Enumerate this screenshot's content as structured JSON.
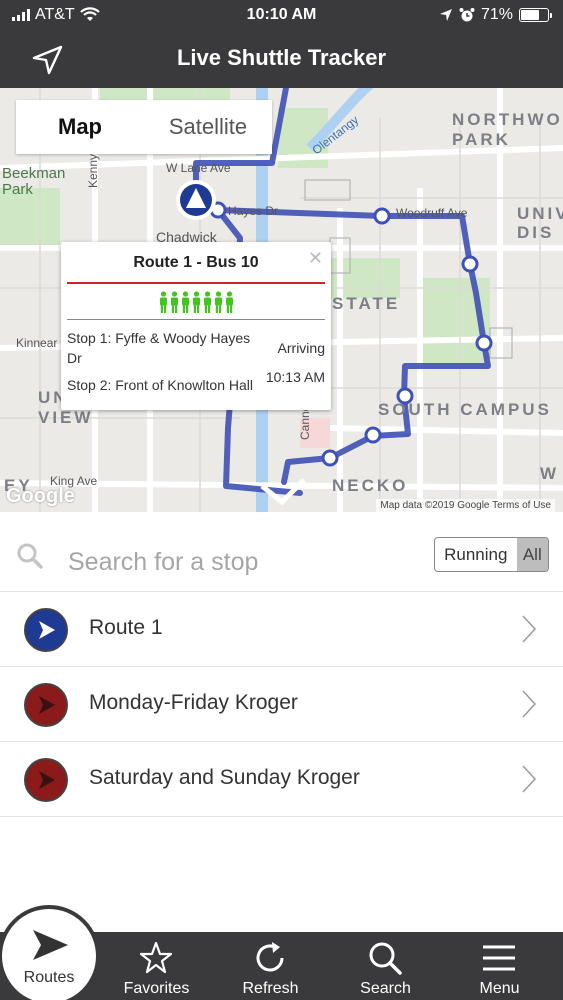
{
  "status_bar": {
    "carrier": "AT&T",
    "time": "10:10 AM",
    "battery": "71%"
  },
  "header": {
    "title": "Live Shuttle Tracker",
    "location_icon": "location-arrow-icon"
  },
  "map": {
    "map_tab": "Map",
    "satellite_tab": "Satellite",
    "selected_view": "Map",
    "areas": [
      "NORTHWOOD PARK",
      "UNIV DIS",
      "SOUTH CAMPUS",
      "NECKO",
      "W",
      "UNIV VIEW",
      "STATE",
      "EY"
    ],
    "streets": [
      "Beekman Park",
      "Kenny Rd",
      "Chadwick",
      "W Lane Ave",
      "Olentangy",
      "Woodruff Ave",
      "Kinnear",
      "King Ave",
      "Cannon",
      "Hayes Dr"
    ],
    "google": "Google",
    "attribution": "Map data ©2019 Google   Terms of Use",
    "route_color": "#3f51b5",
    "popup": {
      "title": "Route 1 - Bus 10",
      "occupancy_count": 7,
      "occupancy_color": "#43c520",
      "stops": [
        {
          "name": "Stop 1: Fyffe & Woody Hayes Dr",
          "eta": "Arriving"
        },
        {
          "name": "Stop 2: Front of Knowlton Hall",
          "eta": "10:13 AM"
        }
      ]
    }
  },
  "search": {
    "placeholder": "Search for a stop",
    "value": ""
  },
  "filter": {
    "running_label": "Running",
    "all_label": "All",
    "selected": "All"
  },
  "routes": [
    {
      "name": "Route 1",
      "icon": "route-play-icon",
      "color": "#1f3a93"
    },
    {
      "name": "Monday-Friday Kroger",
      "icon": "route-play-icon",
      "color": "#8b1a1a"
    },
    {
      "name": "Saturday and Sunday Kroger",
      "icon": "route-play-icon",
      "color": "#8b1a1a"
    }
  ],
  "tabs": [
    {
      "label": "Routes",
      "icon": "play-icon",
      "active": true
    },
    {
      "label": "Favorites",
      "icon": "star-icon"
    },
    {
      "label": "Refresh",
      "icon": "refresh-icon"
    },
    {
      "label": "Search",
      "icon": "search-icon"
    },
    {
      "label": "Menu",
      "icon": "menu-icon"
    }
  ]
}
